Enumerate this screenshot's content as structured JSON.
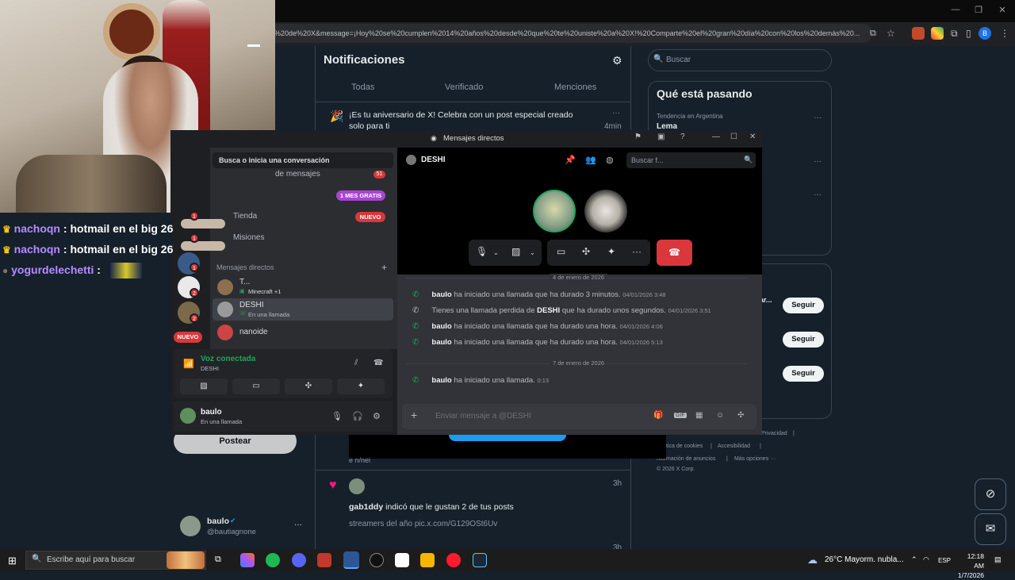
{
  "browser": {
    "url_fragment": "%20de%20X&message=¡Hoy%20se%20cumplen%2014%20años%20desde%20que%20te%20uniste%20a%20X!%20Comparte%20el%20gran%20día%20con%20los%20demás%20...",
    "profile_initial": "B"
  },
  "twitter": {
    "notifications_title": "Notificaciones",
    "tabs": [
      "Todas",
      "Verificado",
      "Menciones"
    ],
    "anniversary_text": "¡Es tu aniversario de X! Celebra con un post especial creado solo para ti",
    "anniversary_time": "4min",
    "search_placeholder": "Buscar",
    "trends_title": "Qué está pasando",
    "trend_context": "Tendencia en Argentina",
    "trend_name": "Lema",
    "who_fragment": "ar...",
    "follow_label": "Seguir",
    "footer_links": [
      "Privacidad",
      "|",
      "tica de cookies",
      "|",
      "Accesibilidad",
      "|",
      "nformación de anuncios",
      "|",
      "Más opciones ···",
      "© 2026 X Corp."
    ],
    "post_button": "Postear",
    "crumb_text": "e n/nei",
    "like_time": "3h",
    "like_text_user": "gab1ddy",
    "like_text_rest": " indicó que le gustan 2 de tus posts",
    "like_sub": "streamers del año pic.x.com/G129OSt6Uv",
    "bottom_time": "3h",
    "me_name": "baulo",
    "me_handle": "@bautiagnone"
  },
  "stream_chat": [
    {
      "user": "nachoqn",
      "message": "hotmail en el big 26",
      "crown": true
    },
    {
      "user": "nachoqn",
      "message": "hotmail en el big 26",
      "crown": true
    },
    {
      "user": "yogurdelechetti",
      "message": "",
      "crown": false
    }
  ],
  "stream_chat_separator": " : ",
  "discord": {
    "window_title": "Mensajes directos",
    "start_conversation": "Busca o inicia una conversación",
    "row_messages": "de mensajes",
    "row_messages_count": "51",
    "nitro_badge": "1 MES GRATIS",
    "store_label": "Tienda",
    "store_badge": "NUEVO",
    "missions_label": "Misiones",
    "dm_header": "Mensajes directos",
    "dms": [
      {
        "name": "T...",
        "sub": "Minecraft +1",
        "color": "#8b6f4e"
      },
      {
        "name": "DESHI",
        "sub": "En una llamada",
        "color": "#9a9a9a"
      },
      {
        "name": "nanoide",
        "sub": "",
        "color": "#c44"
      }
    ],
    "guild_badges": [
      "1",
      "1",
      "1",
      "2",
      "2"
    ],
    "nuevo_pill": "NUEVO",
    "voice_title": "Voz conectada",
    "voice_channel": "DESHI",
    "user_name": "baulo",
    "user_status": "En una llamada",
    "channel_name": "DESHI",
    "search_placeholder": "Buscar f...",
    "date_1": "4 de enero de 2026",
    "date_2": "7 de enero de 2026",
    "logs": [
      {
        "user": "baulo",
        "text": " ha iniciado una llamada que ha durado 3 minutos.",
        "ts": "04/01/2026 3:48",
        "missed": false
      },
      {
        "prefix": "Tienes una llamada perdida de ",
        "user": "DESHI",
        "text": " que ha durado unos segundos.",
        "ts": "04/01/2026 3:51",
        "missed": true
      },
      {
        "user": "baulo",
        "text": " ha iniciado una llamada que ha durado una hora.",
        "ts": "04/01/2026 4:06",
        "missed": false
      },
      {
        "user": "baulo",
        "text": " ha iniciado una llamada que ha durado una hora.",
        "ts": "04/01/2026 5:13",
        "missed": false
      },
      {
        "user": "baulo",
        "text": " ha iniciado una llamada.",
        "ts": "0:13",
        "missed": false
      }
    ],
    "message_placeholder": "Enviar mensaje a @DESHI"
  },
  "taskbar": {
    "search_placeholder": "Escribe aquí para buscar",
    "weather": "26°C  Mayorm. nubla...",
    "language": "ESP",
    "time": "12:18 AM",
    "date": "1/7/2026"
  },
  "colors": {
    "twitter_bg": "#15202b",
    "discord_green": "#23a55a",
    "discord_red": "#da373c",
    "nitro_purple": "#a845d1",
    "twitter_blue": "#1d9bf0"
  }
}
